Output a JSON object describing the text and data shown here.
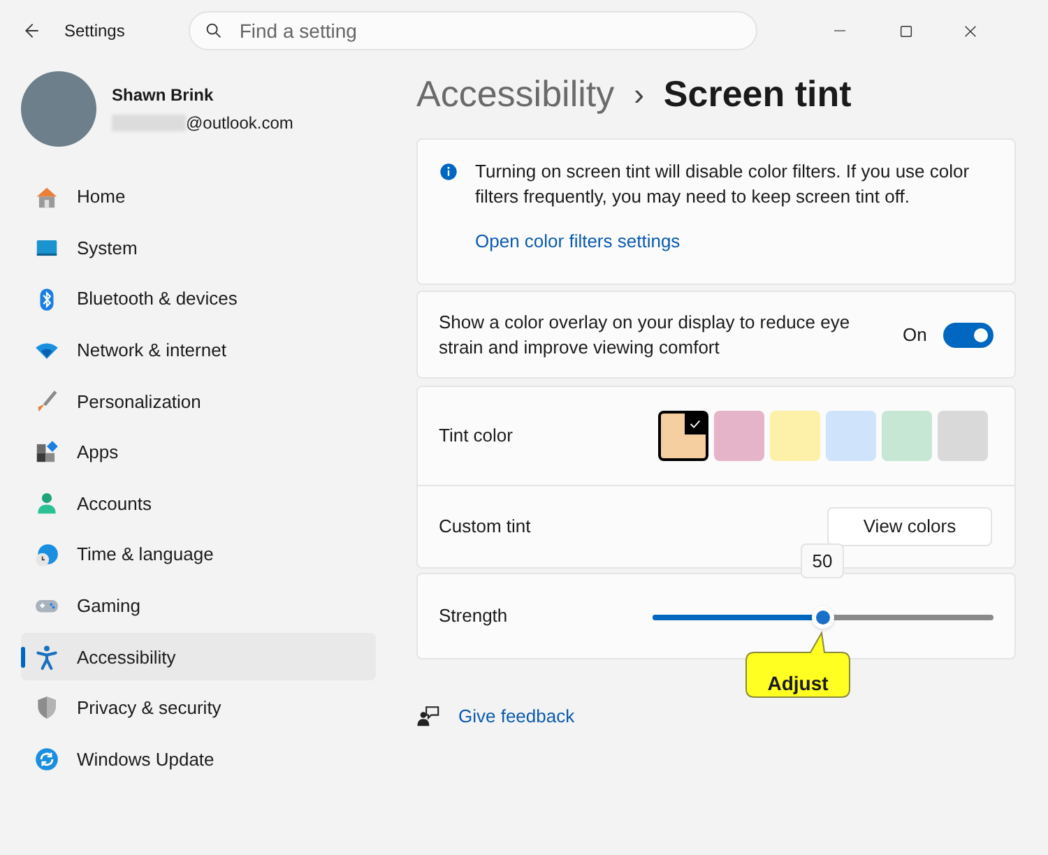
{
  "window": {
    "title": "Settings"
  },
  "search": {
    "placeholder": "Find a setting"
  },
  "account": {
    "name": "Shawn Brink",
    "email": "@outlook.com"
  },
  "nav": [
    {
      "label": "Home",
      "kind": "home",
      "selected": false
    },
    {
      "label": "System",
      "kind": "system",
      "selected": false
    },
    {
      "label": "Bluetooth & devices",
      "kind": "bluetooth",
      "selected": false
    },
    {
      "label": "Network & internet",
      "kind": "network",
      "selected": false
    },
    {
      "label": "Personalization",
      "kind": "brush",
      "selected": false
    },
    {
      "label": "Apps",
      "kind": "apps",
      "selected": false
    },
    {
      "label": "Accounts",
      "kind": "accounts",
      "selected": false
    },
    {
      "label": "Time & language",
      "kind": "time",
      "selected": false
    },
    {
      "label": "Gaming",
      "kind": "gaming",
      "selected": false
    },
    {
      "label": "Accessibility",
      "kind": "accessibility",
      "selected": true
    },
    {
      "label": "Privacy & security",
      "kind": "shield",
      "selected": false
    },
    {
      "label": "Windows Update",
      "kind": "update",
      "selected": false
    }
  ],
  "breadcrumb": {
    "parent": "Accessibility",
    "separator": "›",
    "current": "Screen tint"
  },
  "info": {
    "text": "Turning on screen tint will disable color filters. If you use color filters frequently, you may need to keep screen tint off.",
    "link": "Open color filters settings"
  },
  "overlay": {
    "label": "Show a color overlay on your display to reduce eye strain and improve viewing comfort",
    "state_text": "On",
    "on": true
  },
  "tint": {
    "label": "Tint color",
    "swatches": [
      {
        "color": "#f5cfa0",
        "selected": true
      },
      {
        "color": "#e6b4c8",
        "selected": false
      },
      {
        "color": "#fdf0a9",
        "selected": false
      },
      {
        "color": "#cfe4fb",
        "selected": false
      },
      {
        "color": "#c6e7d4",
        "selected": false
      },
      {
        "color": "#d9d9d9",
        "selected": false
      }
    ]
  },
  "custom_tint": {
    "label": "Custom tint",
    "button": "View colors"
  },
  "strength": {
    "label": "Strength",
    "level": 0.5,
    "tooltip": "50"
  },
  "callout": {
    "text": "Adjust"
  },
  "feedback": {
    "link": "Give feedback"
  }
}
